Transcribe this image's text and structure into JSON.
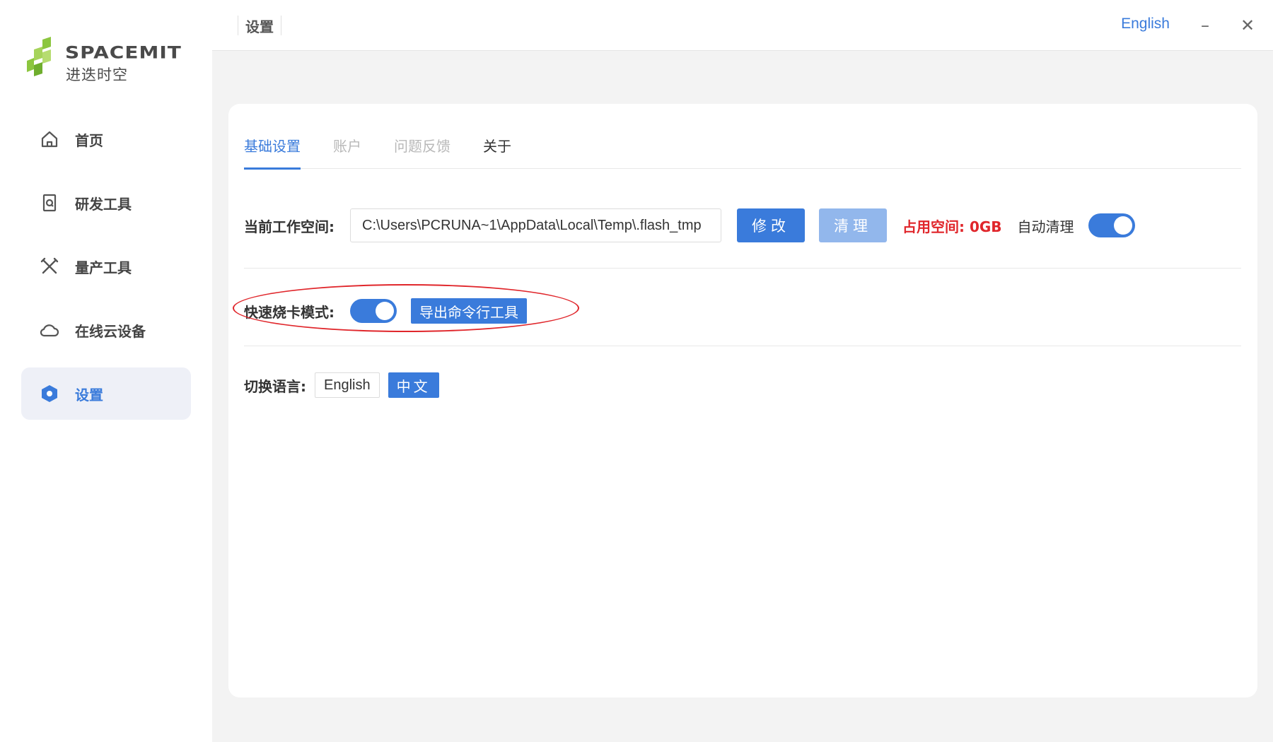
{
  "sidebar": {
    "logo_text_en": "SPACEMIT",
    "logo_text_cn": "进迭时空",
    "items": [
      {
        "label": "首页",
        "icon": "home-icon"
      },
      {
        "label": "研发工具",
        "icon": "dev-tools-icon"
      },
      {
        "label": "量产工具",
        "icon": "production-tools-icon"
      },
      {
        "label": "在线云设备",
        "icon": "cloud-icon"
      },
      {
        "label": "设置",
        "icon": "settings-hexagon-icon",
        "active": true
      }
    ]
  },
  "titlebar": {
    "title": "设置",
    "language_switch": "English",
    "minimize": "–",
    "close": "✕"
  },
  "tabs": [
    {
      "label": "基础设置",
      "state": "active"
    },
    {
      "label": "账户",
      "state": "disabled"
    },
    {
      "label": "问题反馈",
      "state": "disabled"
    },
    {
      "label": "关于",
      "state": "normal"
    }
  ],
  "workspace": {
    "label": "当前工作空间:",
    "path": "C:\\Users\\PCRUNA~1\\AppData\\Local\\Temp\\.flash_tmp",
    "modify_label": "修改",
    "clean_label": "清理",
    "usage_text": "占用空间: 0GB",
    "auto_clean_label": "自动清理",
    "auto_clean_enabled": true
  },
  "fast_flash": {
    "label": "快速烧卡模式:",
    "enabled": true,
    "export_label": "导出命令行工具"
  },
  "language": {
    "label": "切换语言:",
    "options": [
      "English",
      "中文"
    ],
    "selected": "中文"
  },
  "colors": {
    "accent": "#3a7bdb",
    "accent_light": "#92b7ec",
    "danger": "#e0262b",
    "logo_green": "#8cc63f"
  }
}
